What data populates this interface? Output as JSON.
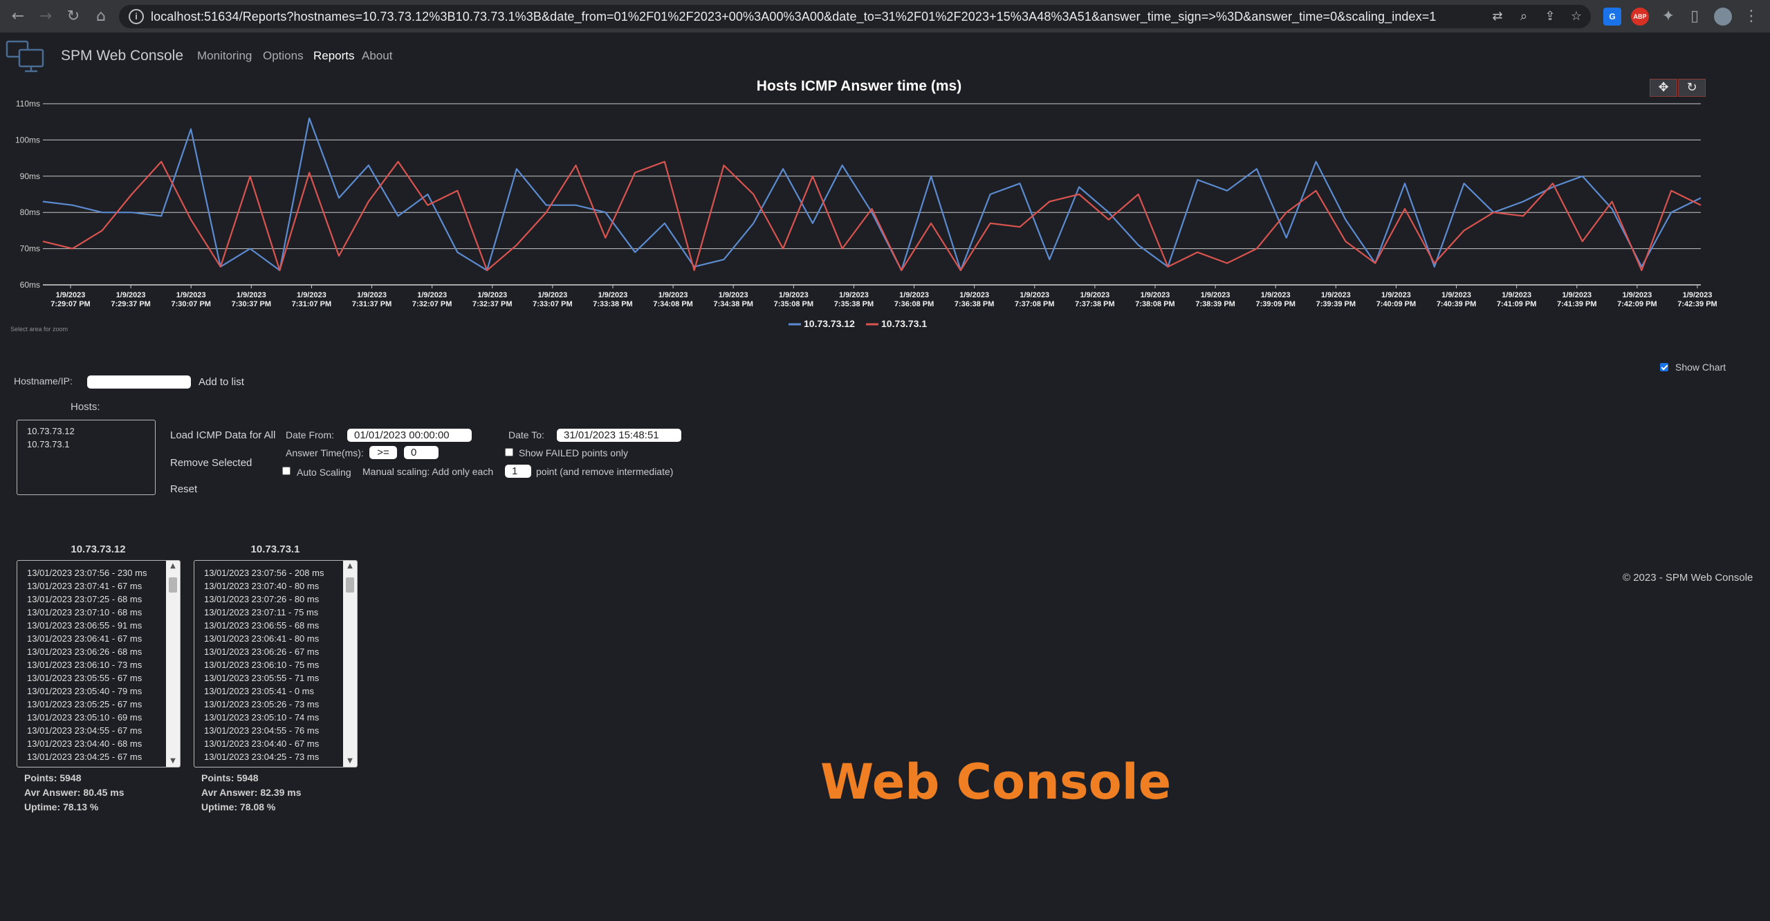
{
  "browser": {
    "url": "localhost:51634/Reports?hostnames=10.73.73.12%3B10.73.73.1%3B&date_from=01%2F01%2F2023+00%3A00%3A00&date_to=31%2F01%2F2023+15%3A48%3A51&answer_time_sign=>%3D&answer_time=0&scaling_index=1",
    "icons": [
      "back-icon",
      "forward-icon",
      "reload-icon",
      "home-icon",
      "info-icon",
      "translate-icon",
      "zoom-icon",
      "share-icon",
      "star-icon",
      "extensions-icon",
      "sidepanel-icon",
      "profile-icon",
      "menu-icon"
    ],
    "abp_label": "ABP"
  },
  "nav": {
    "brand": "SPM Web Console",
    "links": [
      "Monitoring",
      "Options",
      "Reports",
      "About"
    ],
    "active": "Reports"
  },
  "chart_data": {
    "type": "line",
    "title": "Hosts ICMP Answer time (ms)",
    "y_ticks": [
      "60ms",
      "70ms",
      "80ms",
      "90ms",
      "100ms",
      "110ms"
    ],
    "ylim": [
      60,
      110
    ],
    "x_tick_labels": [
      [
        "1/9/2023",
        "7:29:07 PM"
      ],
      [
        "1/9/2023",
        "7:29:37 PM"
      ],
      [
        "1/9/2023",
        "7:30:07 PM"
      ],
      [
        "1/9/2023",
        "7:30:37 PM"
      ],
      [
        "1/9/2023",
        "7:31:07 PM"
      ],
      [
        "1/9/2023",
        "7:31:37 PM"
      ],
      [
        "1/9/2023",
        "7:32:07 PM"
      ],
      [
        "1/9/2023",
        "7:32:37 PM"
      ],
      [
        "1/9/2023",
        "7:33:07 PM"
      ],
      [
        "1/9/2023",
        "7:33:38 PM"
      ],
      [
        "1/9/2023",
        "7:34:08 PM"
      ],
      [
        "1/9/2023",
        "7:34:38 PM"
      ],
      [
        "1/9/2023",
        "7:35:08 PM"
      ],
      [
        "1/9/2023",
        "7:35:38 PM"
      ],
      [
        "1/9/2023",
        "7:36:08 PM"
      ],
      [
        "1/9/2023",
        "7:36:38 PM"
      ],
      [
        "1/9/2023",
        "7:37:08 PM"
      ],
      [
        "1/9/2023",
        "7:37:38 PM"
      ],
      [
        "1/9/2023",
        "7:38:08 PM"
      ],
      [
        "1/9/2023",
        "7:38:39 PM"
      ],
      [
        "1/9/2023",
        "7:39:09 PM"
      ],
      [
        "1/9/2023",
        "7:39:39 PM"
      ],
      [
        "1/9/2023",
        "7:40:09 PM"
      ],
      [
        "1/9/2023",
        "7:40:39 PM"
      ],
      [
        "1/9/2023",
        "7:41:09 PM"
      ],
      [
        "1/9/2023",
        "7:41:39 PM"
      ],
      [
        "1/9/2023",
        "7:42:09 PM"
      ],
      [
        "1/9/2023",
        "7:42:39 PM"
      ]
    ],
    "series": [
      {
        "name": "10.73.73.12",
        "color": "#5b8bd0",
        "values": [
          83,
          82,
          80,
          80,
          79,
          103,
          65,
          70,
          64,
          106,
          84,
          93,
          79,
          85,
          69,
          64,
          92,
          82,
          82,
          80,
          69,
          77,
          65,
          67,
          77,
          92,
          77,
          93,
          80,
          64,
          90,
          64,
          85,
          88,
          67,
          87,
          80,
          71,
          65,
          89,
          86,
          92,
          73,
          94,
          78,
          66,
          88,
          65,
          88,
          80,
          83,
          87,
          90,
          81,
          65,
          80,
          84
        ]
      },
      {
        "name": "10.73.73.1",
        "color": "#d9534f",
        "values": [
          72,
          70,
          75,
          85,
          94,
          78,
          65,
          90,
          64,
          91,
          68,
          83,
          94,
          82,
          86,
          64,
          71,
          80,
          93,
          73,
          91,
          94,
          64,
          93,
          85,
          70,
          90,
          70,
          81,
          64,
          77,
          64,
          77,
          76,
          83,
          85,
          78,
          85,
          65,
          69,
          66,
          70,
          80,
          86,
          72,
          66,
          81,
          66,
          75,
          80,
          79,
          88,
          72,
          83,
          64,
          86,
          82
        ]
      }
    ],
    "legend_position": "bottom-center",
    "hint": "Select area for zoom"
  },
  "controls": {
    "hostname_label": "Hostname/IP:",
    "hostname_value": "",
    "add_to_list": "Add to list",
    "show_chart": "Show Chart",
    "show_chart_checked": true,
    "hosts_label": "Hosts:",
    "hosts": [
      "10.73.73.12",
      "10.73.73.1"
    ],
    "load_all": "Load ICMP Data for All",
    "remove_selected": "Remove Selected",
    "reset": "Reset",
    "date_from_label": "Date From:",
    "date_from": "01/01/2023 00:00:00",
    "date_to_label": "Date To:",
    "date_to": "31/01/2023 15:48:51",
    "answer_time_label": "Answer Time(ms):",
    "answer_sign": ">=",
    "answer_value": "0",
    "show_failed": "Show FAILED points only",
    "auto_scaling": "Auto Scaling",
    "manual_scaling": "Manual scaling: Add only each",
    "scaling_value": "1",
    "scaling_suffix": "point (and remove intermediate)"
  },
  "hosts_panels": [
    {
      "host": "10.73.73.12",
      "entries": [
        "13/01/2023 23:07:56 - 230 ms",
        "13/01/2023 23:07:41 - 67 ms",
        "13/01/2023 23:07:25 - 68 ms",
        "13/01/2023 23:07:10 - 68 ms",
        "13/01/2023 23:06:55 - 91 ms",
        "13/01/2023 23:06:41 - 67 ms",
        "13/01/2023 23:06:26 - 68 ms",
        "13/01/2023 23:06:10 - 73 ms",
        "13/01/2023 23:05:55 - 67 ms",
        "13/01/2023 23:05:40 - 79 ms",
        "13/01/2023 23:05:25 - 67 ms",
        "13/01/2023 23:05:10 - 69 ms",
        "13/01/2023 23:04:55 - 67 ms",
        "13/01/2023 23:04:40 - 68 ms",
        "13/01/2023 23:04:25 - 67 ms"
      ],
      "points": "Points: 5948",
      "avg": "Avr Answer: 80.45 ms",
      "uptime": "Uptime: 78.13 %"
    },
    {
      "host": "10.73.73.1",
      "entries": [
        "13/01/2023 23:07:56 - 208 ms",
        "13/01/2023 23:07:40 - 80 ms",
        "13/01/2023 23:07:26 - 80 ms",
        "13/01/2023 23:07:11 - 75 ms",
        "13/01/2023 23:06:55 - 68 ms",
        "13/01/2023 23:06:41 - 80 ms",
        "13/01/2023 23:06:26 - 67 ms",
        "13/01/2023 23:06:10 - 75 ms",
        "13/01/2023 23:05:55 - 71 ms",
        "13/01/2023 23:05:41 - 0 ms",
        "13/01/2023 23:05:26 - 73 ms",
        "13/01/2023 23:05:10 - 74 ms",
        "13/01/2023 23:04:55 - 76 ms",
        "13/01/2023 23:04:40 - 67 ms",
        "13/01/2023 23:04:25 - 73 ms"
      ],
      "points": "Points: 5948",
      "avg": "Avr Answer: 82.39 ms",
      "uptime": "Uptime: 78.08 %"
    }
  ],
  "footer": {
    "copyright": "© 2023 - SPM Web Console",
    "big_brand": "Web Console"
  }
}
